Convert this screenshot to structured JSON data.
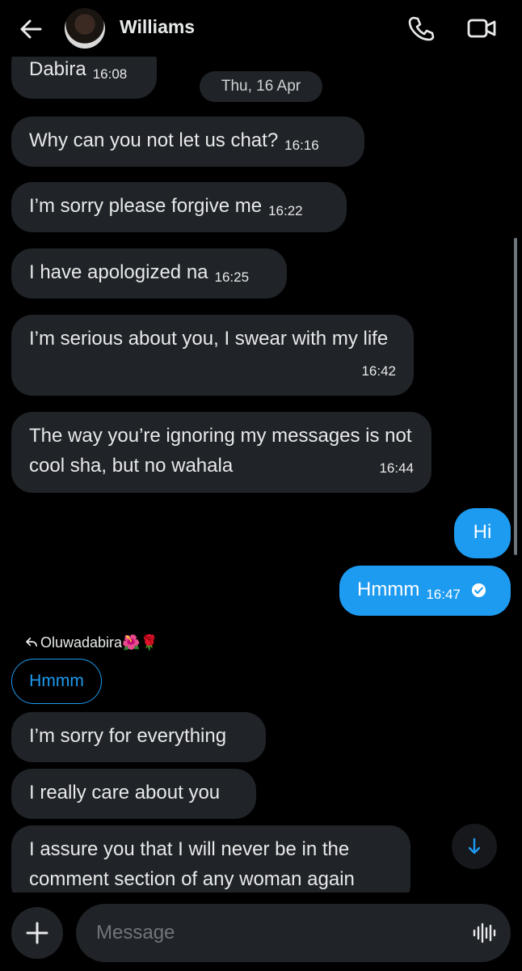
{
  "header": {
    "name": "Williams"
  },
  "date_divider": "Thu, 16 Apr",
  "messages": [
    {
      "text": "Dabira",
      "time": "16:08"
    },
    {
      "text": "Why can you not let us chat?",
      "time": "16:16"
    },
    {
      "text": "I’m sorry please forgive me",
      "time": "16:22"
    },
    {
      "text": "I have apologized na",
      "time": "16:25"
    },
    {
      "text": "I’m serious about you, I swear with my life",
      "time": "16:42"
    },
    {
      "text": "The way you’re ignoring my messages is not cool sha, but no wahala",
      "time": "16:44"
    },
    {
      "text": "Hi"
    },
    {
      "text": "Hmmm",
      "time": "16:47"
    },
    {
      "text": "I’m sorry for everything"
    },
    {
      "text": "I really care about you"
    },
    {
      "text": "I assure you that I will never be in the comment section of any woman again"
    }
  ],
  "reply": {
    "label": "Oluwadabira🌺🌹",
    "quoted_text": "Hmmm"
  },
  "composer": {
    "placeholder": "Message"
  },
  "colors": {
    "accent": "#1d9bf0",
    "bubble_in": "#202327",
    "background": "#000000"
  }
}
